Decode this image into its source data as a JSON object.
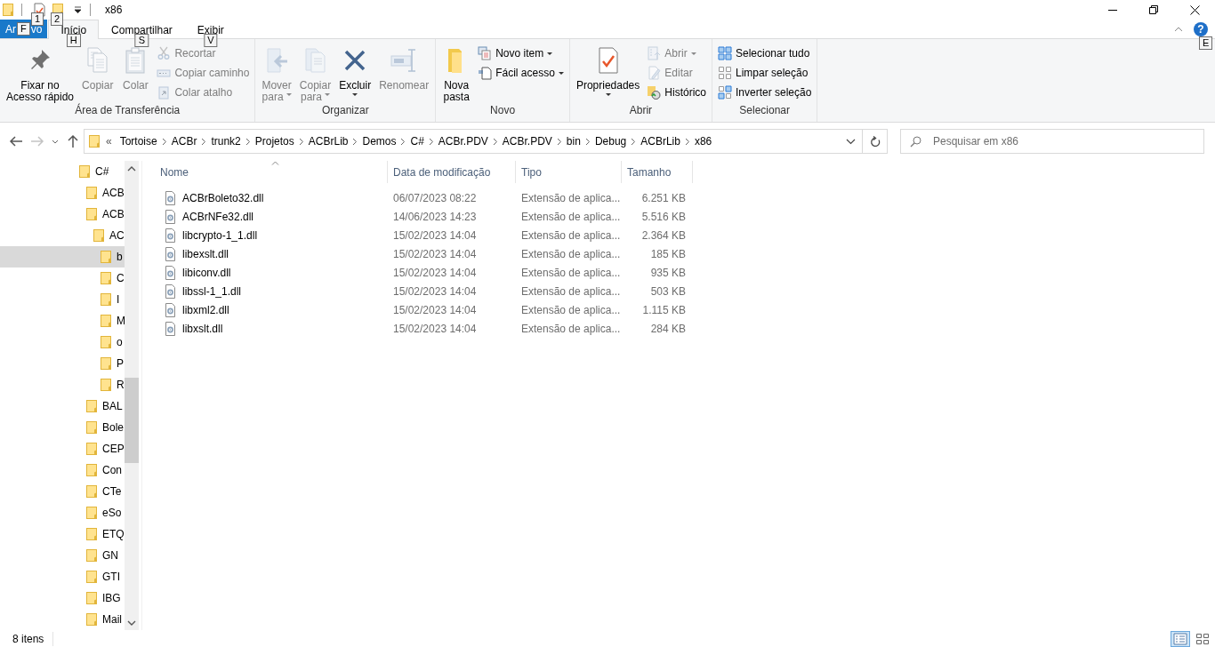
{
  "window": {
    "title": "x86",
    "quick_access": [
      {
        "keytip": "1"
      },
      {
        "keytip": "2"
      }
    ]
  },
  "tabs": [
    {
      "kind": "file",
      "label_parts": [
        "Ar",
        "vo"
      ],
      "keytip": "F",
      "selected": false
    },
    {
      "kind": "tab",
      "label": "Início",
      "keytip": "H",
      "selected": true
    },
    {
      "kind": "tab",
      "label": "Compartilhar",
      "keytip": "S",
      "selected": false
    },
    {
      "kind": "tab",
      "label": "Exibir",
      "keytip": "V",
      "selected": false
    }
  ],
  "help": {
    "symbol": "?",
    "keytip": "E"
  },
  "ribbon": {
    "groups": [
      {
        "label": "Área de Transferência",
        "columns": [
          [
            {
              "kind": "large",
              "lines": [
                "Fixar no",
                "Acesso rápido"
              ],
              "disabled": false
            }
          ],
          [
            {
              "kind": "large",
              "lines": [
                "Copiar"
              ],
              "disabled": true
            }
          ],
          [
            {
              "kind": "large",
              "lines": [
                "Colar"
              ],
              "disabled": true
            }
          ],
          [
            {
              "kind": "small",
              "label": "Recortar",
              "disabled": true
            },
            {
              "kind": "small",
              "label": "Copiar caminho",
              "disabled": true
            },
            {
              "kind": "small",
              "label": "Colar atalho",
              "disabled": true
            }
          ]
        ]
      },
      {
        "label": "Organizar",
        "columns": [
          [
            {
              "kind": "large",
              "lines": [
                "Mover",
                "para"
              ],
              "dropdown": true,
              "disabled": true
            }
          ],
          [
            {
              "kind": "large",
              "lines": [
                "Copiar",
                "para"
              ],
              "dropdown": true,
              "disabled": true
            }
          ],
          [
            {
              "kind": "large",
              "lines": [
                "Excluir"
              ],
              "dropdown": true,
              "disabled": false
            }
          ],
          [
            {
              "kind": "large",
              "lines": [
                "Renomear"
              ],
              "disabled": true
            }
          ]
        ]
      },
      {
        "label": "Novo",
        "columns": [
          [
            {
              "kind": "large",
              "lines": [
                "Nova",
                "pasta"
              ],
              "disabled": false
            }
          ],
          [
            {
              "kind": "small",
              "label": "Novo item",
              "dropdown": true,
              "disabled": false
            },
            {
              "kind": "small",
              "label": "Fácil acesso",
              "dropdown": true,
              "disabled": false
            }
          ]
        ]
      },
      {
        "label": "Abrir",
        "columns": [
          [
            {
              "kind": "large",
              "lines": [
                "Propriedades"
              ],
              "dropdown": true,
              "disabled": false
            }
          ],
          [
            {
              "kind": "small",
              "label": "Abrir",
              "dropdown": true,
              "disabled": true
            },
            {
              "kind": "small",
              "label": "Editar",
              "disabled": true
            },
            {
              "kind": "small",
              "label": "Histórico",
              "disabled": false
            }
          ]
        ]
      },
      {
        "label": "Selecionar",
        "columns": [
          [
            {
              "kind": "small",
              "label": "Selecionar tudo",
              "disabled": false
            },
            {
              "kind": "small",
              "label": "Limpar seleção",
              "disabled": false
            },
            {
              "kind": "small",
              "label": "Inverter seleção",
              "disabled": false
            }
          ]
        ]
      }
    ]
  },
  "address": {
    "overflow_marker": "«",
    "segments": [
      "Tortoise",
      "ACBr",
      "trunk2",
      "Projetos",
      "ACBrLib",
      "Demos",
      "C#",
      "ACBr.PDV",
      "ACBr.PDV",
      "bin",
      "Debug",
      "ACBrLib",
      "x86"
    ]
  },
  "search": {
    "placeholder": "Pesquisar em x86"
  },
  "nav": {
    "items": [
      {
        "label": "C#",
        "selected": false,
        "children": [
          {
            "label": "ACB",
            "selected": false
          },
          {
            "label": "ACB",
            "selected": false,
            "children": [
              {
                "label": "AC",
                "selected": false,
                "children": [
                  {
                    "label": "b",
                    "selected": true
                  },
                  {
                    "label": "C",
                    "selected": false
                  },
                  {
                    "label": "I",
                    "selected": false
                  },
                  {
                    "label": "M",
                    "selected": false
                  },
                  {
                    "label": "o",
                    "selected": false
                  },
                  {
                    "label": "P",
                    "selected": false
                  },
                  {
                    "label": "R",
                    "selected": false
                  }
                ]
              }
            ]
          },
          {
            "label": "BAL",
            "selected": false
          },
          {
            "label": "Bole",
            "selected": false
          },
          {
            "label": "CEP",
            "selected": false
          },
          {
            "label": "Con",
            "selected": false
          },
          {
            "label": "CTe",
            "selected": false
          },
          {
            "label": "eSo",
            "selected": false
          },
          {
            "label": "ETQ",
            "selected": false
          },
          {
            "label": "GN",
            "selected": false
          },
          {
            "label": "GTI",
            "selected": false
          },
          {
            "label": "IBG",
            "selected": false
          },
          {
            "label": "Mail",
            "selected": false
          }
        ]
      }
    ]
  },
  "files": {
    "columns": [
      {
        "label": "Nome",
        "sorted": true
      },
      {
        "label": "Data de modificação",
        "sorted": false
      },
      {
        "label": "Tipo",
        "sorted": false
      },
      {
        "label": "Tamanho",
        "sorted": false
      }
    ],
    "rows": [
      {
        "name": "ACBrBoleto32.dll",
        "modified": "06/07/2023 08:22",
        "type": "Extensão de aplica...",
        "size": "6.251 KB"
      },
      {
        "name": "ACBrNFe32.dll",
        "modified": "14/06/2023 14:23",
        "type": "Extensão de aplica...",
        "size": "5.516 KB"
      },
      {
        "name": "libcrypto-1_1.dll",
        "modified": "15/02/2023 14:04",
        "type": "Extensão de aplica...",
        "size": "2.364 KB"
      },
      {
        "name": "libexslt.dll",
        "modified": "15/02/2023 14:04",
        "type": "Extensão de aplica...",
        "size": "185 KB"
      },
      {
        "name": "libiconv.dll",
        "modified": "15/02/2023 14:04",
        "type": "Extensão de aplica...",
        "size": "935 KB"
      },
      {
        "name": "libssl-1_1.dll",
        "modified": "15/02/2023 14:04",
        "type": "Extensão de aplica...",
        "size": "503 KB"
      },
      {
        "name": "libxml2.dll",
        "modified": "15/02/2023 14:04",
        "type": "Extensão de aplica...",
        "size": "1.115 KB"
      },
      {
        "name": "libxslt.dll",
        "modified": "15/02/2023 14:04",
        "type": "Extensão de aplica...",
        "size": "284 KB"
      }
    ]
  },
  "status_bar": {
    "count": "8 itens",
    "views": [
      {
        "selected": true
      },
      {
        "selected": false
      }
    ]
  }
}
